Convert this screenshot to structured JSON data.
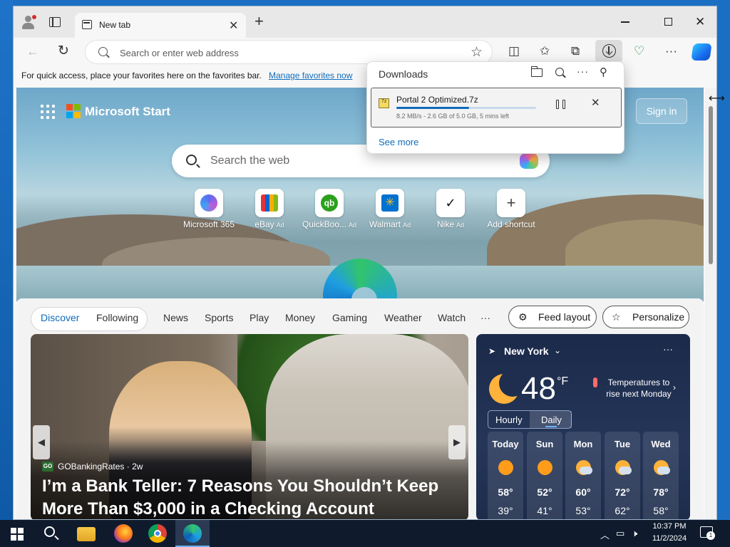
{
  "browser": {
    "tab_title": "New tab",
    "address_placeholder": "Search or enter web address"
  },
  "favorites_bar": {
    "text": "For quick access, place your favorites here on the favorites bar.",
    "link": "Manage favorites now"
  },
  "downloads": {
    "title": "Downloads",
    "file_name": "Portal 2 Optimized.7z",
    "status": "8.2 MB/s - 2.6 GB of 5.0 GB, 5 mins left",
    "progress": 0.52,
    "see_more": "See more"
  },
  "start_page": {
    "brand": "Microsoft Start",
    "sign_in": "Sign in",
    "search_placeholder": "Search the web",
    "shortcuts": [
      {
        "label": "Microsoft 365",
        "ad": ""
      },
      {
        "label": "eBay",
        "ad": "Ad"
      },
      {
        "label": "QuickBoo...",
        "ad": "Ad"
      },
      {
        "label": "Walmart",
        "ad": "Ad"
      },
      {
        "label": "Nike",
        "ad": "Ad"
      },
      {
        "label": "Add shortcut",
        "ad": ""
      }
    ],
    "feed_tabs": {
      "discover": "Discover",
      "following": "Following"
    },
    "nav": [
      "News",
      "Sports",
      "Play",
      "Money",
      "Gaming",
      "Weather",
      "Watch",
      "···"
    ],
    "feed_layout": "Feed layout",
    "personalize": "Personalize"
  },
  "story": {
    "source": "GOBankingRates",
    "source_badge": "GO",
    "age": "· 2w",
    "headline": "I’m a Bank Teller: 7 Reasons You Shouldn’t Keep More Than $3,000 in a Checking Account"
  },
  "weather": {
    "location": "New York",
    "temp": "48",
    "unit": "°F",
    "alert": "Temperatures to rise next Monday",
    "toggle": {
      "hourly": "Hourly",
      "daily": "Daily"
    },
    "days": [
      {
        "name": "Today",
        "hi": "58°",
        "lo": "39°",
        "icon": "sunny-icon"
      },
      {
        "name": "Sun",
        "hi": "52°",
        "lo": "41°",
        "icon": "sunny-icon"
      },
      {
        "name": "Mon",
        "hi": "60°",
        "lo": "53°",
        "icon": "partly-cloudy-icon"
      },
      {
        "name": "Tue",
        "hi": "72°",
        "lo": "62°",
        "icon": "partly-cloudy-icon"
      },
      {
        "name": "Wed",
        "hi": "78°",
        "lo": "58°",
        "icon": "partly-cloudy-icon"
      }
    ]
  },
  "taskbar": {
    "time": "10:37 PM",
    "date": "11/2/2024",
    "notification_count": "1"
  },
  "colors": {
    "accent": "#0f6cbd",
    "window_frame": "#1b6fc2",
    "taskbar": "#0f1b2d"
  }
}
